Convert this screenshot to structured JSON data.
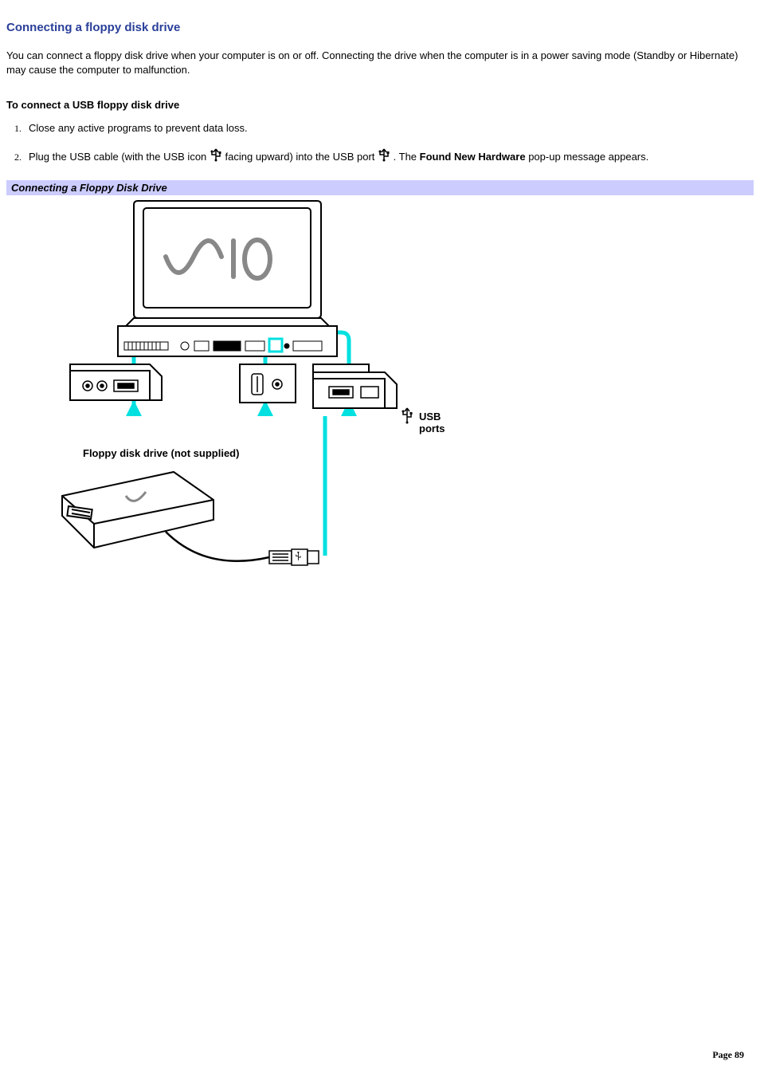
{
  "heading": "Connecting a floppy disk drive",
  "intro": "You can connect a floppy disk drive when your computer is on or off. Connecting the drive when the computer is in a power saving mode (Standby or Hibernate) may cause the computer to malfunction.",
  "subheading": "To connect a USB floppy disk drive",
  "steps": {
    "step1": "Close any active programs to prevent data loss.",
    "step2_part1": "Plug the USB cable (with the USB icon ",
    "step2_part2": " facing upward) into the USB port ",
    "step2_part3": " . The ",
    "step2_bold": "Found New Hardware",
    "step2_part4": " pop-up message appears."
  },
  "caption": "Connecting a Floppy Disk Drive",
  "diagram": {
    "usb_ports_label": "USB ports",
    "floppy_label": "Floppy disk drive (not supplied)",
    "brand": "VAIO"
  },
  "page_label": "Page 89"
}
